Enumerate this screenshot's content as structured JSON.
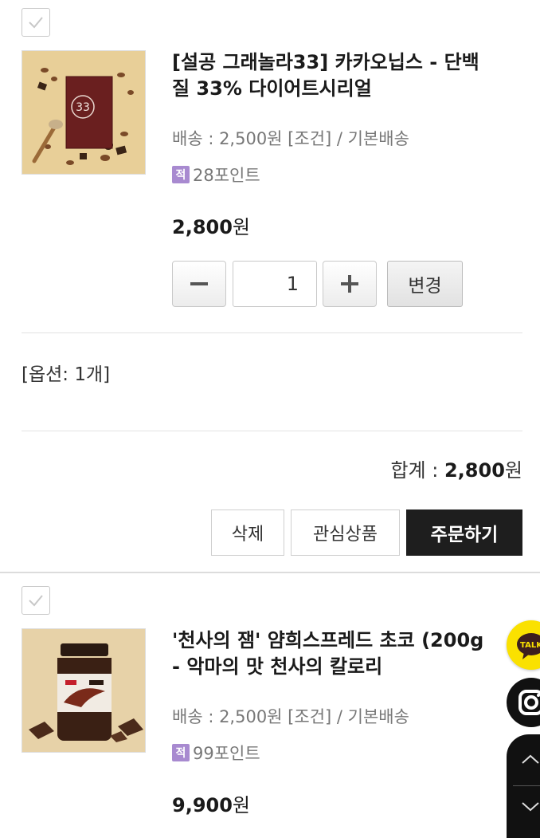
{
  "items": [
    {
      "title_line1": "[설공 그래놀라33] 카카오닙스 - 단백",
      "title_line2": "질 33% 다이어트시리얼",
      "thumb_text": "33",
      "shipping": "배송 : 2,500원 [조건] / 기본배송",
      "points_badge": "적",
      "points": "28포인트",
      "price_num": "2,800",
      "price_unit": "원",
      "qty": "1",
      "change_label": "변경",
      "option": "[옵션: 1개]",
      "total_label": "합계 : ",
      "total_num": "2,800",
      "total_unit": "원",
      "delete_label": "삭제",
      "wish_label": "관심상품",
      "order_label": "주문하기"
    },
    {
      "title_line1": "'천사의 잼' 얌희스프레드 초코 (200g",
      "title_line2": "- 악마의 맛 천사의 칼로리",
      "shipping": "배송 : 2,500원 [조건] / 기본배송",
      "points_badge": "적",
      "points": "99포인트",
      "price_num": "9,900",
      "price_unit": "원"
    }
  ],
  "floating": {
    "talk_label": "TALK"
  },
  "icons": [
    "check-icon",
    "minus-icon",
    "plus-icon",
    "kakao-talk-icon",
    "instagram-icon",
    "chevron-up-icon",
    "chevron-down-icon"
  ],
  "colors": {
    "order_button": "#1e1e1e",
    "points_badge": "#a88ad0",
    "kakao_yellow": "#fae100"
  }
}
